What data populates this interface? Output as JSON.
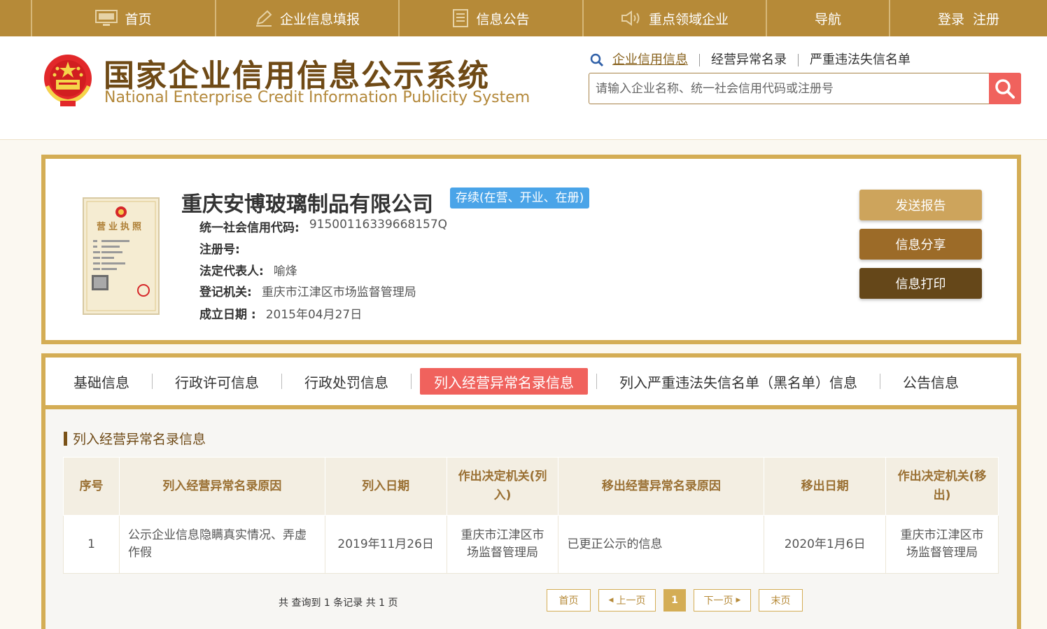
{
  "topnav": {
    "items": [
      {
        "label": "首页",
        "icon": "monitor-icon"
      },
      {
        "label": "企业信息填报",
        "icon": "pen-icon"
      },
      {
        "label": "信息公告",
        "icon": "document-icon"
      },
      {
        "label": "重点领域企业",
        "icon": "speaker-icon"
      },
      {
        "label": "导航",
        "icon": ""
      },
      {
        "label": "登录  注册",
        "icon": ""
      }
    ]
  },
  "header": {
    "title": "国家企业信用信息公示系统",
    "subtitle": "National Enterprise Credit Information Publicity System",
    "search_links": [
      "企业信用信息",
      "经营异常名录",
      "严重违法失信名单"
    ],
    "search_placeholder": "请输入企业名称、统一社会信用代码或注册号"
  },
  "company": {
    "name": "重庆安博玻璃制品有限公司",
    "status": "存续(在营、开业、在册)",
    "fields": [
      {
        "label": "统一社会信用代码:",
        "value": "91500116339668157Q"
      },
      {
        "label": "注册号:",
        "value": ""
      },
      {
        "label": "法定代表人:",
        "value": "喻烽"
      },
      {
        "label": "登记机关:",
        "value": "重庆市江津区市场监督管理局"
      },
      {
        "label": "成立日期 :",
        "value": "2015年04月27日"
      }
    ],
    "license_label": "营业执照"
  },
  "actions": [
    {
      "label": "发送报告",
      "color": "#cda45c"
    },
    {
      "label": "信息分享",
      "color": "#9c6b28"
    },
    {
      "label": "信息打印",
      "color": "#654719"
    }
  ],
  "tabs": [
    {
      "label": "基础信息",
      "active": false
    },
    {
      "label": "行政许可信息",
      "active": false
    },
    {
      "label": "行政处罚信息",
      "active": false
    },
    {
      "label": "列入经营异常名录信息",
      "active": true
    },
    {
      "label": "列入严重违法失信名单（黑名单）信息",
      "active": false
    },
    {
      "label": "公告信息",
      "active": false
    }
  ],
  "section_title": "列入经营异常名录信息",
  "table": {
    "headers": [
      "序号",
      "列入经营异常名录原因",
      "列入日期",
      "作出决定机关(列入)",
      "移出经营异常名录原因",
      "移出日期",
      "作出决定机关(移出)"
    ],
    "rows": [
      [
        "1",
        "公示企业信息隐瞒真实情况、弄虚作假",
        "2019年11月26日",
        "重庆市江津区市场监督管理局",
        "已更正公示的信息",
        "2020年1月6日",
        "重庆市江津区市场监督管理局"
      ]
    ]
  },
  "pager": {
    "info": "共 查询到 1 条记录 共 1 页",
    "first": "首页",
    "prev": "上一页",
    "current": "1",
    "next": "下一页",
    "last": "末页"
  },
  "colors": {
    "gold": "#b68a38",
    "accent_red": "#f0625d",
    "status_blue": "#4aa4e8",
    "title_brown": "#6f4a16"
  }
}
